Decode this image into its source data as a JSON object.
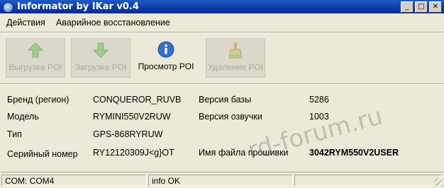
{
  "window": {
    "title": "Informator by IKar v0.4"
  },
  "menu": {
    "items": [
      "Действия",
      "Аварийное восстановление"
    ]
  },
  "toolbar": {
    "buttons": [
      {
        "label": "Выгрузка POI",
        "icon": "arrow-up-icon",
        "enabled": false
      },
      {
        "label": "Загрузка POI",
        "icon": "arrow-down-icon",
        "enabled": false
      },
      {
        "label": "Просмотр POI",
        "icon": "info-icon",
        "enabled": true
      },
      {
        "label": "Удаление POI",
        "icon": "broom-icon",
        "enabled": false
      }
    ]
  },
  "info": {
    "left": [
      {
        "label": "Бренд (регион)",
        "value": "CONQUEROR_RUVB"
      },
      {
        "label": "Модель",
        "value": "RYMINI550V2RUW"
      },
      {
        "label": "Тип",
        "value": "GPS-868RYRUW"
      },
      {
        "label": "Серийный номер",
        "value": "RY12120309J<g}OT"
      }
    ],
    "right": [
      {
        "label": "Версия базы",
        "value": "5286"
      },
      {
        "label": "Версия озвучки",
        "value": "1003"
      },
      {
        "label": "Имя файла прошивки",
        "value": "3042RYM550V2USER"
      }
    ]
  },
  "watermark": "rd-forum.ru",
  "status": {
    "port": "COM: COM4",
    "message": "info OK"
  },
  "colors": {
    "titlebar": "#0a3aa8",
    "face": "#ece9d8",
    "info_icon": "#2f6fd6"
  }
}
